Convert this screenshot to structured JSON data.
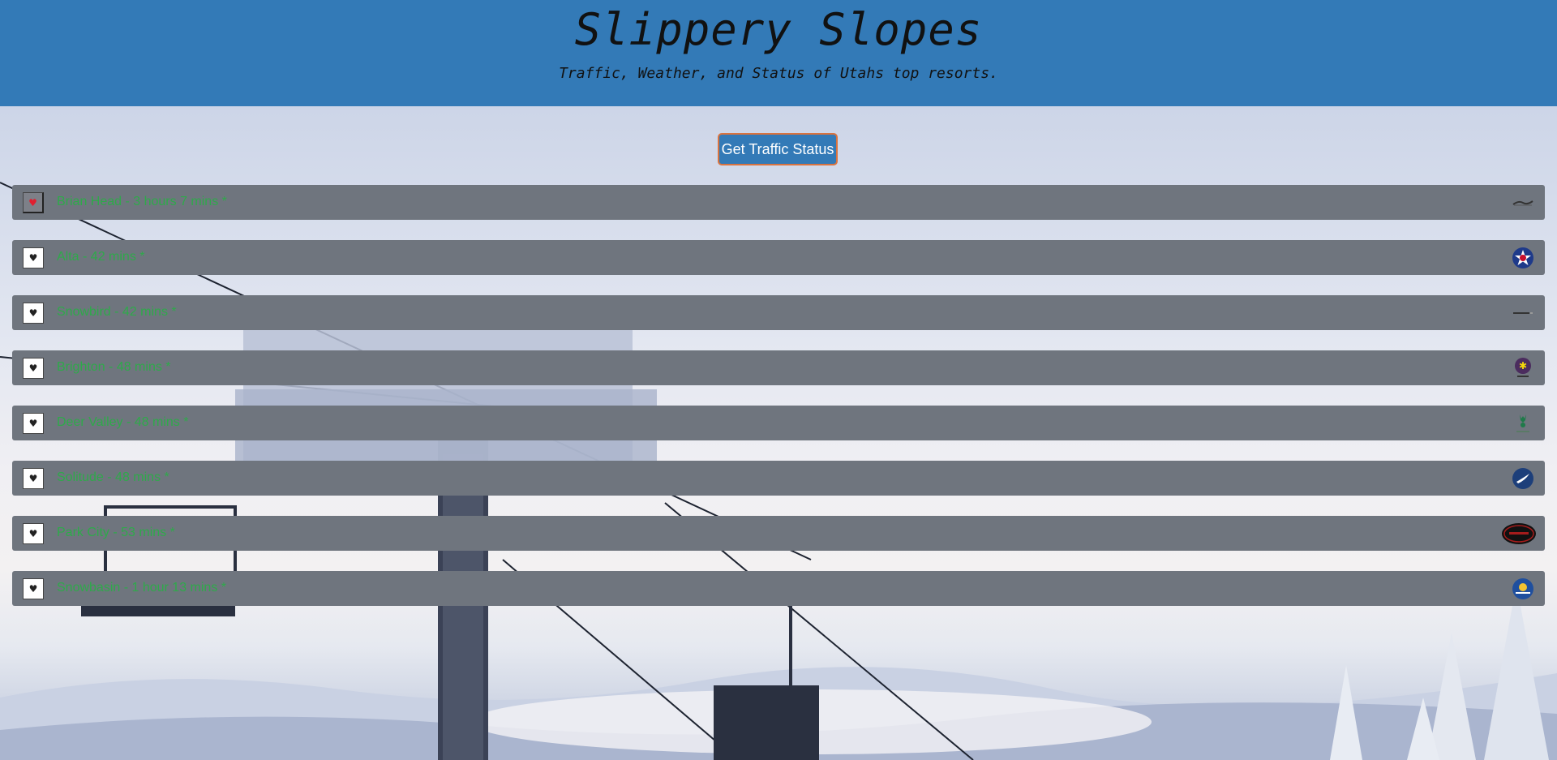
{
  "header": {
    "title": "Slippery Slopes",
    "subtitle": "Traffic, Weather, and Status of Utahs top resorts."
  },
  "traffic_button_label": "Get Traffic Status",
  "resorts": [
    {
      "text": "Brian Head - 3 hours 7 mins *",
      "favorite": true,
      "logo": "brian-head-logo-icon"
    },
    {
      "text": "Alta - 42 mins *",
      "favorite": false,
      "logo": "alta-logo-icon"
    },
    {
      "text": "Snowbird - 42 mins *",
      "favorite": false,
      "logo": "snowbird-logo-icon"
    },
    {
      "text": "Brighton - 48 mins *",
      "favorite": false,
      "logo": "brighton-logo-icon"
    },
    {
      "text": "Deer Valley - 48 mins *",
      "favorite": false,
      "logo": "deer-valley-logo-icon"
    },
    {
      "text": "Solitude - 48 mins *",
      "favorite": false,
      "logo": "solitude-logo-icon"
    },
    {
      "text": "Park City - 53 mins *",
      "favorite": false,
      "logo": "park-city-logo-icon"
    },
    {
      "text": "Snowbasin - 1 hour 13 mins *",
      "favorite": false,
      "logo": "snowbasin-logo-icon"
    }
  ],
  "colors": {
    "header_bg": "#337ab7",
    "row_bg": "#6f757e",
    "resort_text": "#2eaa4a",
    "button_border": "#d9733f",
    "favorite_heart": "#e01e2f"
  },
  "icons": {
    "favorite": "heart-icon",
    "background": "ski-lift-background-image"
  }
}
